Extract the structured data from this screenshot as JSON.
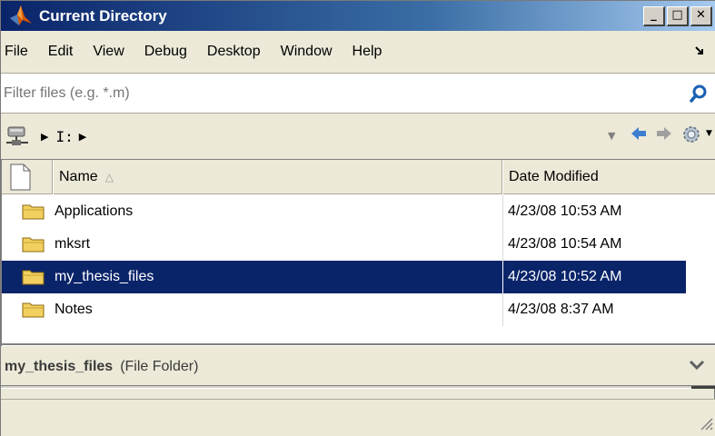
{
  "window": {
    "title": "Current Directory",
    "minimize_label": "_",
    "maximize_label": "□",
    "close_label": "✕"
  },
  "menu": {
    "items": [
      "File",
      "Edit",
      "View",
      "Debug",
      "Desktop",
      "Window",
      "Help"
    ],
    "undock_icon": "undock-arrow-icon"
  },
  "filter": {
    "placeholder": "Filter files (e.g. *.m)",
    "icon": "search-icon"
  },
  "address": {
    "root_icon": "network-drive-icon",
    "path": [
      "I:"
    ],
    "nav_icons": [
      "back-icon",
      "forward-icon",
      "gear-icon"
    ]
  },
  "table": {
    "columns": [
      "Name",
      "Date Modified"
    ],
    "sort_indicator": "△",
    "rows": [
      {
        "name": "Applications",
        "date": "4/23/08 10:53 AM",
        "selected": false
      },
      {
        "name": "mksrt",
        "date": "4/23/08 10:54 AM",
        "selected": false
      },
      {
        "name": "my_thesis_files",
        "date": "4/23/08 10:52 AM",
        "selected": true
      },
      {
        "name": "Notes",
        "date": "4/23/08 8:37 AM",
        "selected": false
      }
    ]
  },
  "details": {
    "name": "my_thesis_files",
    "type": "(File Folder)"
  },
  "colors": {
    "selection": "#0a246a",
    "titlebar_start": "#0a246a",
    "titlebar_end": "#a6caf0",
    "folder": "#f2d060",
    "nav_arrow": "#3c7ed0"
  }
}
